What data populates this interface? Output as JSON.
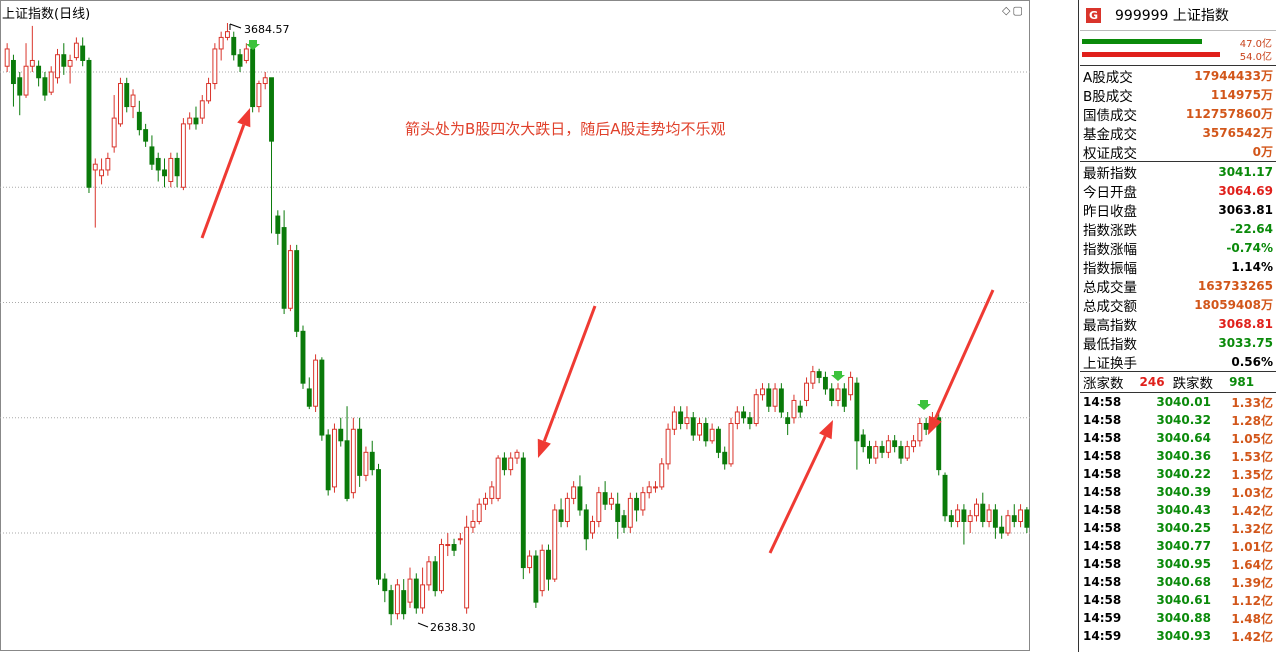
{
  "chart_title": "上证指数(日线)",
  "icons": [
    "diamond-icon",
    "window-icon"
  ],
  "chart_data": {
    "type": "candlestick",
    "yticks": [
      2800,
      2900,
      3000,
      3100,
      3200,
      3300,
      3400,
      3500,
      3600
    ],
    "ylim": [
      2620,
      3720
    ],
    "grid": true,
    "annotations": {
      "high": "3684.57",
      "low": "2638.30",
      "note": "箭头处为B股四次大跌日，随后A股走势均不乐观"
    },
    "candles": [
      [
        3610,
        3640,
        3600,
        3650
      ],
      [
        3620,
        3580,
        3540,
        3630
      ],
      [
        3590,
        3560,
        3525,
        3600
      ],
      [
        3560,
        3610,
        3555,
        3650
      ],
      [
        3610,
        3620,
        3600,
        3680
      ],
      [
        3610,
        3590,
        3575,
        3620
      ],
      [
        3590,
        3560,
        3550,
        3600
      ],
      [
        3565,
        3600,
        3560,
        3610
      ],
      [
        3590,
        3630,
        3580,
        3640
      ],
      [
        3630,
        3610,
        3595,
        3650
      ],
      [
        3610,
        3620,
        3580,
        3630
      ],
      [
        3625,
        3650,
        3620,
        3660
      ],
      [
        3645,
        3620,
        3610,
        3660
      ],
      [
        3620,
        3400,
        3390,
        3625
      ],
      [
        3430,
        3440,
        3330,
        3450
      ],
      [
        3420,
        3430,
        3405,
        3450
      ],
      [
        3430,
        3450,
        3420,
        3460
      ],
      [
        3470,
        3520,
        3460,
        3560
      ],
      [
        3510,
        3580,
        3505,
        3590
      ],
      [
        3580,
        3540,
        3530,
        3590
      ],
      [
        3540,
        3560,
        3520,
        3570
      ],
      [
        3530,
        3500,
        3490,
        3550
      ],
      [
        3500,
        3480,
        3470,
        3510
      ],
      [
        3470,
        3440,
        3430,
        3490
      ],
      [
        3450,
        3430,
        3410,
        3460
      ],
      [
        3430,
        3420,
        3400,
        3450
      ],
      [
        3410,
        3450,
        3400,
        3460
      ],
      [
        3450,
        3420,
        3400,
        3460
      ],
      [
        3400,
        3510,
        3395,
        3520
      ],
      [
        3510,
        3520,
        3500,
        3530
      ],
      [
        3520,
        3510,
        3500,
        3540
      ],
      [
        3520,
        3550,
        3510,
        3560
      ],
      [
        3550,
        3580,
        3545,
        3590
      ],
      [
        3580,
        3640,
        3570,
        3650
      ],
      [
        3640,
        3660,
        3620,
        3670
      ],
      [
        3660,
        3670,
        3655,
        3685
      ],
      [
        3660,
        3630,
        3620,
        3670
      ],
      [
        3630,
        3610,
        3600,
        3640
      ],
      [
        3620,
        3640,
        3615,
        3650
      ],
      [
        3640,
        3540,
        3530,
        3640
      ],
      [
        3540,
        3580,
        3530,
        3585
      ],
      [
        3580,
        3590,
        3570,
        3600
      ],
      [
        3590,
        3480,
        3320,
        3590
      ],
      [
        3350,
        3320,
        3300,
        3360
      ],
      [
        3330,
        3190,
        3180,
        3360
      ],
      [
        3190,
        3290,
        3185,
        3300
      ],
      [
        3290,
        3150,
        3140,
        3300
      ],
      [
        3150,
        3060,
        3050,
        3160
      ],
      [
        3050,
        3020,
        3015,
        3070
      ],
      [
        3020,
        3100,
        3010,
        3110
      ],
      [
        3100,
        2970,
        2960,
        3105
      ],
      [
        2970,
        2875,
        2865,
        2980
      ],
      [
        2880,
        2980,
        2870,
        2990
      ],
      [
        2980,
        2960,
        2950,
        3000
      ],
      [
        2960,
        2860,
        2855,
        3020
      ],
      [
        2870,
        2980,
        2860,
        3000
      ],
      [
        2980,
        2900,
        2880,
        3000
      ],
      [
        2900,
        2940,
        2890,
        2950
      ],
      [
        2940,
        2910,
        2900,
        2960
      ],
      [
        2910,
        2720,
        2710,
        2920
      ],
      [
        2720,
        2700,
        2680,
        2730
      ],
      [
        2700,
        2660,
        2640,
        2710
      ],
      [
        2660,
        2710,
        2650,
        2720
      ],
      [
        2700,
        2660,
        2650,
        2720
      ],
      [
        2680,
        2720,
        2670,
        2740
      ],
      [
        2720,
        2670,
        2660,
        2730
      ],
      [
        2670,
        2710,
        2660,
        2740
      ],
      [
        2710,
        2750,
        2700,
        2760
      ],
      [
        2750,
        2700,
        2690,
        2760
      ],
      [
        2700,
        2780,
        2695,
        2790
      ],
      [
        2780,
        2780,
        2760,
        2800
      ],
      [
        2780,
        2770,
        2760,
        2790
      ],
      [
        2790,
        2790,
        2780,
        2800
      ],
      [
        2670,
        2810,
        2660,
        2830
      ],
      [
        2810,
        2820,
        2800,
        2840
      ],
      [
        2820,
        2850,
        2815,
        2860
      ],
      [
        2850,
        2860,
        2840,
        2870
      ],
      [
        2860,
        2880,
        2850,
        2890
      ],
      [
        2860,
        2930,
        2855,
        2935
      ],
      [
        2930,
        2910,
        2900,
        2940
      ],
      [
        2910,
        2930,
        2900,
        2940
      ],
      [
        2930,
        2940,
        2920,
        2945
      ],
      [
        2930,
        2740,
        2720,
        2940
      ],
      [
        2740,
        2760,
        2730,
        2770
      ],
      [
        2760,
        2680,
        2670,
        2770
      ],
      [
        2700,
        2770,
        2690,
        2780
      ],
      [
        2770,
        2720,
        2700,
        2780
      ],
      [
        2720,
        2840,
        2715,
        2850
      ],
      [
        2840,
        2820,
        2810,
        2860
      ],
      [
        2820,
        2860,
        2810,
        2870
      ],
      [
        2860,
        2880,
        2850,
        2890
      ],
      [
        2880,
        2840,
        2830,
        2900
      ],
      [
        2840,
        2790,
        2770,
        2850
      ],
      [
        2800,
        2820,
        2790,
        2830
      ],
      [
        2820,
        2870,
        2810,
        2880
      ],
      [
        2870,
        2850,
        2840,
        2890
      ],
      [
        2850,
        2860,
        2840,
        2870
      ],
      [
        2850,
        2820,
        2790,
        2870
      ],
      [
        2830,
        2810,
        2800,
        2840
      ],
      [
        2810,
        2860,
        2800,
        2870
      ],
      [
        2860,
        2840,
        2820,
        2870
      ],
      [
        2840,
        2870,
        2830,
        2880
      ],
      [
        2870,
        2880,
        2860,
        2890
      ],
      [
        2880,
        2880,
        2870,
        2890
      ],
      [
        2880,
        2920,
        2875,
        2930
      ],
      [
        2920,
        2980,
        2910,
        2990
      ],
      [
        2980,
        3010,
        2970,
        3020
      ],
      [
        3010,
        2990,
        2980,
        3020
      ],
      [
        2990,
        3000,
        2980,
        3020
      ],
      [
        3000,
        2970,
        2960,
        3010
      ],
      [
        2970,
        2990,
        2960,
        3000
      ],
      [
        2990,
        2960,
        2950,
        3000
      ],
      [
        2960,
        2980,
        2955,
        2990
      ],
      [
        2980,
        2940,
        2930,
        2985
      ],
      [
        2940,
        2920,
        2910,
        2950
      ],
      [
        2920,
        2990,
        2915,
        3000
      ],
      [
        2990,
        3010,
        2980,
        3020
      ],
      [
        3010,
        3000,
        2990,
        3020
      ],
      [
        3000,
        2990,
        2980,
        3010
      ],
      [
        2990,
        3040,
        2985,
        3050
      ],
      [
        3040,
        3050,
        3030,
        3060
      ],
      [
        3050,
        3020,
        3010,
        3060
      ],
      [
        3020,
        3050,
        3010,
        3060
      ],
      [
        3050,
        3010,
        3000,
        3060
      ],
      [
        3000,
        2990,
        2970,
        3010
      ],
      [
        3000,
        3030,
        2990,
        3040
      ],
      [
        3020,
        3010,
        3000,
        3030
      ],
      [
        3030,
        3060,
        3020,
        3070
      ],
      [
        3060,
        3080,
        3050,
        3090
      ],
      [
        3080,
        3070,
        3060,
        3085
      ],
      [
        3070,
        3050,
        3040,
        3080
      ],
      [
        3050,
        3030,
        3020,
        3060
      ],
      [
        3030,
        3050,
        3020,
        3060
      ],
      [
        3050,
        3020,
        3010,
        3060
      ],
      [
        3040,
        3070,
        3030,
        3080
      ],
      [
        3060,
        2960,
        2910,
        3070
      ],
      [
        2970,
        2950,
        2940,
        2980
      ],
      [
        2950,
        2930,
        2920,
        2960
      ],
      [
        2930,
        2950,
        2920,
        2960
      ],
      [
        2950,
        2940,
        2930,
        2960
      ],
      [
        2940,
        2960,
        2930,
        2970
      ],
      [
        2960,
        2950,
        2940,
        2970
      ],
      [
        2950,
        2930,
        2920,
        2960
      ],
      [
        2930,
        2950,
        2925,
        2960
      ],
      [
        2950,
        2960,
        2940,
        2970
      ],
      [
        2960,
        2990,
        2950,
        3000
      ],
      [
        2990,
        2980,
        2970,
        3000
      ],
      [
        2990,
        3000,
        2980,
        3010
      ],
      [
        3000,
        2910,
        2900,
        3010
      ],
      [
        2900,
        2830,
        2820,
        2905
      ],
      [
        2830,
        2820,
        2810,
        2840
      ],
      [
        2820,
        2840,
        2810,
        2850
      ],
      [
        2840,
        2820,
        2780,
        2850
      ],
      [
        2820,
        2830,
        2800,
        2840
      ],
      [
        2830,
        2850,
        2820,
        2860
      ],
      [
        2850,
        2820,
        2810,
        2870
      ],
      [
        2820,
        2840,
        2810,
        2850
      ],
      [
        2840,
        2810,
        2790,
        2850
      ],
      [
        2810,
        2800,
        2790,
        2830
      ],
      [
        2800,
        2830,
        2795,
        2840
      ],
      [
        2830,
        2820,
        2810,
        2850
      ],
      [
        2820,
        2840,
        2810,
        2850
      ],
      [
        2840,
        2810,
        2800,
        2845
      ]
    ]
  },
  "panel": {
    "badge": "G",
    "header": "999999 上证指数",
    "vol_bars": [
      {
        "value": "47.0亿",
        "frac": 0.87,
        "color": "#0a8a0a"
      },
      {
        "value": "54.0亿",
        "frac": 1.0,
        "color": "#e0201b"
      }
    ],
    "trade_rows": [
      {
        "label": "A股成交",
        "value": "17944433万"
      },
      {
        "label": "B股成交",
        "value": "114975万"
      },
      {
        "label": "国债成交",
        "value": "112757860万"
      },
      {
        "label": "基金成交",
        "value": "3576542万"
      },
      {
        "label": "权证成交",
        "value": "0万"
      }
    ],
    "index_rows": [
      {
        "label": "最新指数",
        "value": "3041.17",
        "color": "green"
      },
      {
        "label": "今日开盘",
        "value": "3064.69",
        "color": "red"
      },
      {
        "label": "昨日收盘",
        "value": "3063.81",
        "color": "black"
      },
      {
        "label": "指数涨跌",
        "value": "-22.64",
        "color": "green"
      },
      {
        "label": "指数涨幅",
        "value": "-0.74%",
        "color": "green"
      },
      {
        "label": "指数振幅",
        "value": "1.14%",
        "color": "black"
      },
      {
        "label": "总成交量",
        "value": "163733265",
        "color": "orange"
      },
      {
        "label": "总成交额",
        "value": "18059408万",
        "color": "orange"
      },
      {
        "label": "最高指数",
        "value": "3068.81",
        "color": "red"
      },
      {
        "label": "最低指数",
        "value": "3033.75",
        "color": "green"
      },
      {
        "label": "上证换手",
        "value": "0.56%",
        "color": "black"
      }
    ],
    "counts": {
      "up_label": "涨家数",
      "up": "246",
      "down_label": "跌家数",
      "down": "981"
    },
    "ticks": [
      {
        "time": "14:58",
        "price": "3040.01",
        "amount": "1.33亿"
      },
      {
        "time": "14:58",
        "price": "3040.32",
        "amount": "1.28亿"
      },
      {
        "time": "14:58",
        "price": "3040.64",
        "amount": "1.05亿"
      },
      {
        "time": "14:58",
        "price": "3040.36",
        "amount": "1.53亿"
      },
      {
        "time": "14:58",
        "price": "3040.22",
        "amount": "1.35亿"
      },
      {
        "time": "14:58",
        "price": "3040.39",
        "amount": "1.03亿"
      },
      {
        "time": "14:58",
        "price": "3040.43",
        "amount": "1.42亿"
      },
      {
        "time": "14:58",
        "price": "3040.25",
        "amount": "1.32亿"
      },
      {
        "time": "14:58",
        "price": "3040.77",
        "amount": "1.01亿"
      },
      {
        "time": "14:58",
        "price": "3040.95",
        "amount": "1.64亿"
      },
      {
        "time": "14:58",
        "price": "3040.68",
        "amount": "1.39亿"
      },
      {
        "time": "14:58",
        "price": "3040.61",
        "amount": "1.12亿"
      },
      {
        "time": "14:59",
        "price": "3040.88",
        "amount": "1.48亿"
      },
      {
        "time": "14:59",
        "price": "3040.93",
        "amount": "1.42亿"
      }
    ]
  }
}
